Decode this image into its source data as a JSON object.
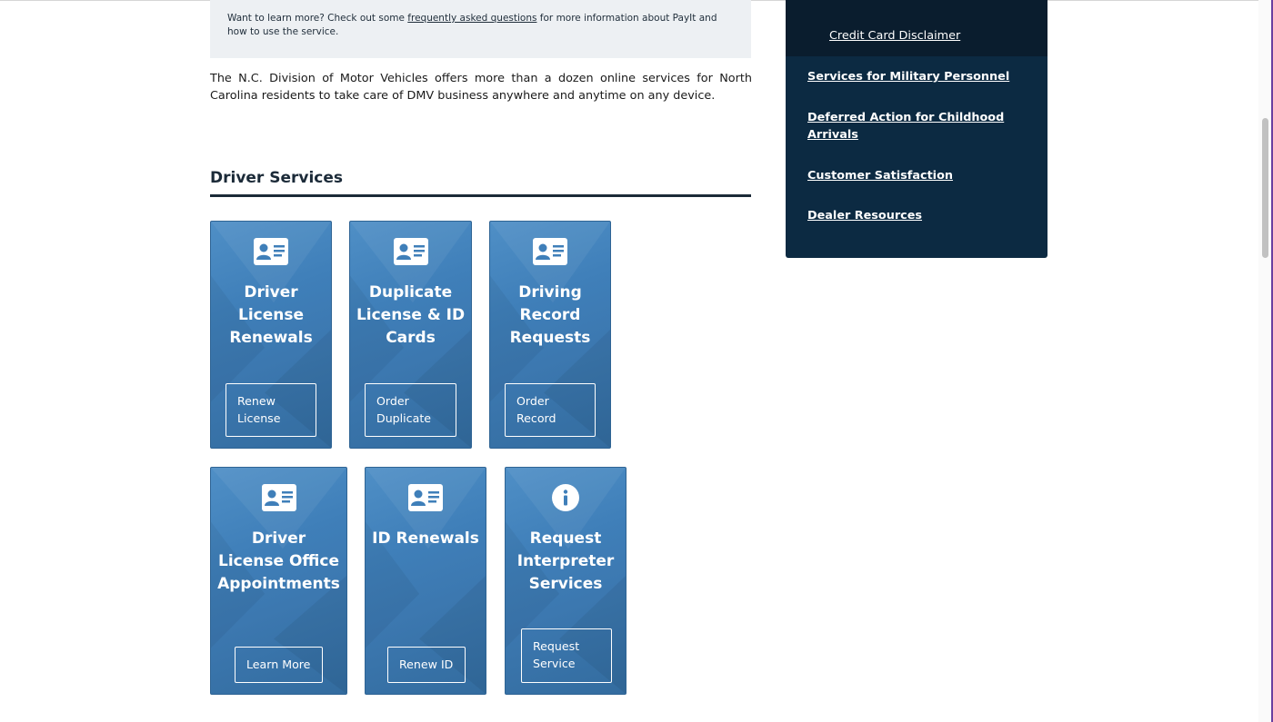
{
  "info_box": {
    "text_before": "Want to learn more? Check out some ",
    "link": "frequently asked questions",
    "text_after": " for more information about PayIt and how to use the service."
  },
  "intro": "The N.C. Division of Motor Vehicles offers more than a dozen online services for North Carolina residents to take care of DMV business anywhere and anytime on any device.",
  "section_title": "Driver Services",
  "cards": [
    {
      "title": "Driver License Renewals",
      "button": "Renew License",
      "icon": "id-card-icon"
    },
    {
      "title": "Duplicate License & ID Cards",
      "button": "Order Duplicate",
      "icon": "id-card-icon"
    },
    {
      "title": "Driving Record Requests",
      "button": "Order Record",
      "icon": "id-card-icon"
    },
    {
      "title": "Driver License Office Appointments",
      "button": "Learn More",
      "icon": "id-card-icon"
    },
    {
      "title": "ID Renewals",
      "button": "Renew ID",
      "icon": "id-card-icon"
    },
    {
      "title": "Request Interpreter Services",
      "button": "Request Service",
      "icon": "info-circle-icon"
    }
  ],
  "sidebar": {
    "sub_item": "Credit Card Disclaimer",
    "items": [
      "Services for Military Personnel",
      "Deferred Action for Childhood Arrivals",
      "Customer Satisfaction",
      "Dealer Resources"
    ]
  },
  "colors": {
    "card_blue": "#3f7fb9",
    "sidebar_navy": "#0c2a42",
    "sidebar_sub": "#0a1d2e",
    "heading": "#1b2a38"
  }
}
